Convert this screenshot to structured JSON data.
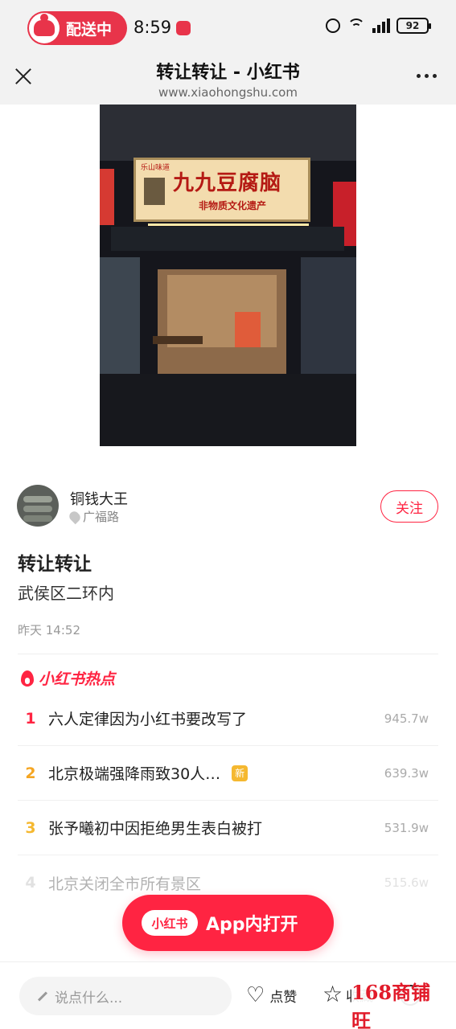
{
  "status_bar": {
    "delivery_label": "配送中",
    "time": "8:59",
    "battery": "92",
    "network": "6"
  },
  "header": {
    "title": "转让转让 - 小红书",
    "url": "www.xiaohongshu.com"
  },
  "photo": {
    "sign_main": "九九豆腐脑",
    "sign_sub": "非物质文化遗产",
    "sign_tag": "乐山味道"
  },
  "author": {
    "name": "铜钱大王",
    "location": "广福路",
    "follow_label": "关注"
  },
  "post": {
    "title": "转让转让",
    "body": "武侯区二环内",
    "time": "昨天 14:52"
  },
  "hot_list": {
    "title": "小红书热点",
    "items": [
      {
        "rank": "1",
        "text": "六人定律因为小红书要改写了",
        "count": "945.7w",
        "badge": "",
        "rank_color": "#ff2442"
      },
      {
        "rank": "2",
        "text": "北京极端强降雨致30人…",
        "count": "639.3w",
        "badge": "新",
        "rank_color": "#f5a623"
      },
      {
        "rank": "3",
        "text": "张予曦初中因拒绝男生表白被打",
        "count": "531.9w",
        "badge": "",
        "rank_color": "#f5b830"
      },
      {
        "rank": "4",
        "text": "北京关闭全市所有景区",
        "count": "515.6w",
        "badge": "",
        "rank_color": "#aaaaaa"
      }
    ]
  },
  "open_app": {
    "logo": "小红书",
    "label": "App内打开"
  },
  "bottom_bar": {
    "comment_placeholder": "说点什么...",
    "like_label": "点赞",
    "collect_label": "收藏"
  },
  "watermark": "168商铺旺",
  "colors": {
    "brand": "#ff2442",
    "status_pill": "#e8344a"
  }
}
